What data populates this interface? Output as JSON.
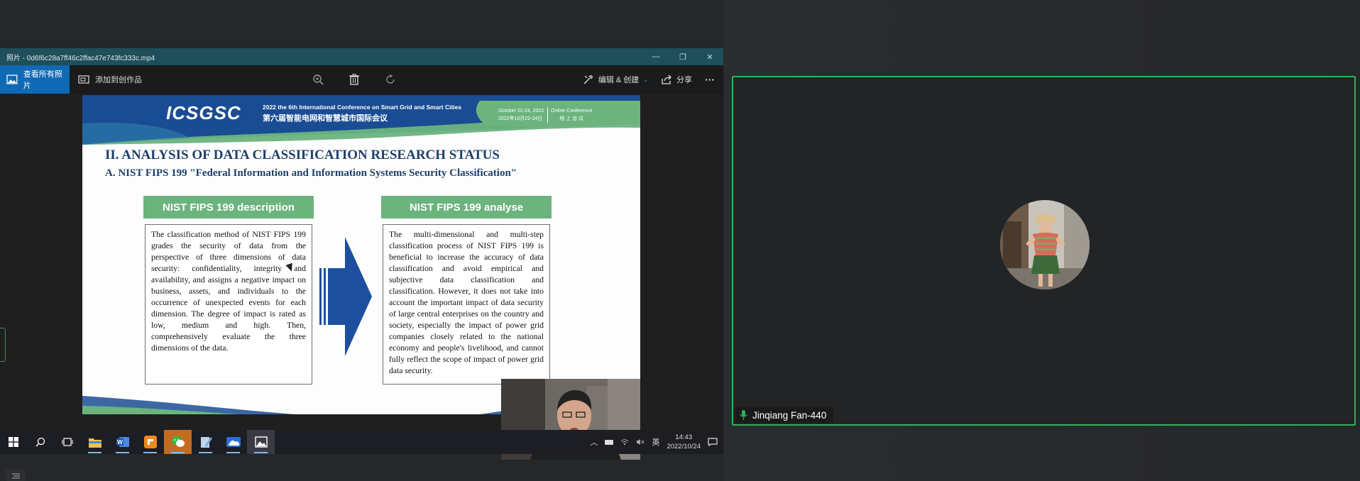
{
  "window": {
    "title": "照片 - 0d6f6c28a7ff46c2ffac47e743fc333c.mp4",
    "controls": [
      "minimize-icon",
      "restore-icon",
      "close-icon"
    ]
  },
  "toolbar": {
    "view_all_label": "查看所有照片",
    "add_to_creation_label": "添加到创作品",
    "edit_create_label": "编辑 & 创建",
    "share_label": "分享",
    "more_label": "···",
    "accent": "#0f69b5"
  },
  "slide": {
    "logo": "ICSGSC",
    "conference_en": "2022 the 6th International Conference on Smart Grid and Smart Cities",
    "conference_cn": "第六届智能电网和智慧城市国际会议",
    "date_en": "October 22-24, 2022",
    "date_cn": "2022年10月22-24日",
    "mode_en": "Online Conference",
    "mode_cn": "线 上 会 议",
    "heading": "II. ANALYSIS OF DATA CLASSIFICATION RESEARCH STATUS",
    "subheading": "A. NIST FIPS 199 \"Federal Information and Information Systems Security Classification\"",
    "left_box_title": "NIST FIPS 199 description",
    "left_box_text": "The classification method of NIST FIPS 199 grades the security of data from the perspective of three dimensions of data security: confidentiality, integrity and availability, and assigns a negative impact on business, assets, and individuals to the occurrence of unexpected events for each dimension. The degree of impact is rated as low, medium and high. Then, comprehensively evaluate the three dimensions of the data.",
    "right_box_title": "NIST FIPS 199 analyse",
    "right_box_text": "The multi-dimensional and multi-step classification process of NIST FIPS 199 is beneficial to increase the accuracy of data classification and avoid empirical and subjective data classification and classification. However, it does not take into account the important impact of data security of large central enterprises on the country and society, especially the impact of power grid companies closely related to the national economy and people's livelihood, and cannot fully reflect the scope of impact of power grid data security."
  },
  "taskbar": {
    "apps": [
      "file-explorer-icon",
      "word-icon",
      "foxit-icon",
      "wechat-icon",
      "notepad-icon",
      "photos-app-icon",
      "photos-icon"
    ],
    "ime": "英",
    "time": "14:43",
    "date": "2022/10/24"
  },
  "participant": {
    "name": "Jinqiang Fan-440",
    "highlight_color": "#2fb15a"
  }
}
